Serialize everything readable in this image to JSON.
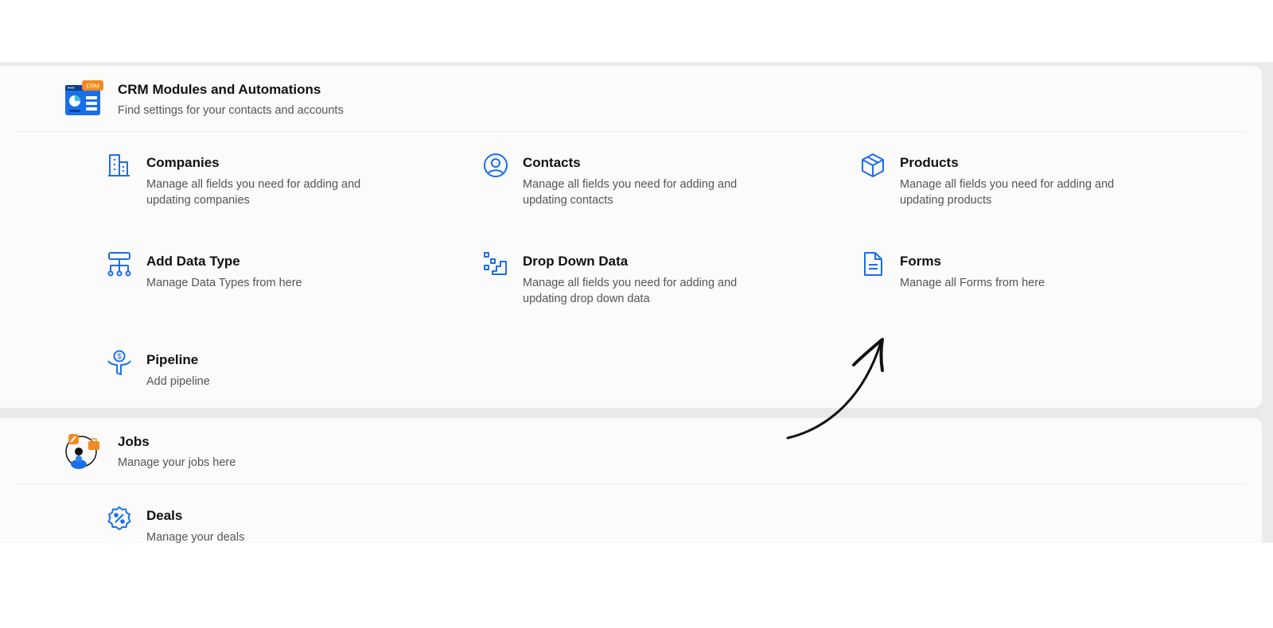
{
  "colors": {
    "accent": "#1a6fe8",
    "orange": "#f08c23",
    "panel_bg": "#fbfbfb",
    "page_gap": "#e9e9e9"
  },
  "crm": {
    "icon": "crm-illustration",
    "badge": "CRM",
    "title": "CRM Modules and Automations",
    "subtitle": "Find settings for your contacts and accounts",
    "items": [
      {
        "icon": "building-icon",
        "title": "Companies",
        "desc": "Manage all fields you need for adding and updating companies"
      },
      {
        "icon": "user-circle-icon",
        "title": "Contacts",
        "desc": "Manage all fields you need for adding and updating contacts"
      },
      {
        "icon": "cube-icon",
        "title": "Products",
        "desc": "Manage all fields you need for adding and updating products"
      },
      {
        "icon": "hierarchy-icon",
        "title": "Add Data Type",
        "desc": "Manage Data Types from here"
      },
      {
        "icon": "stairs-icon",
        "title": "Drop Down Data",
        "desc": "Manage all fields you need for adding and updating drop down data"
      },
      {
        "icon": "document-icon",
        "title": "Forms",
        "desc": "Manage all Forms from here"
      },
      {
        "icon": "funnel-dollar-icon",
        "title": "Pipeline",
        "desc": "Add pipeline"
      }
    ]
  },
  "jobs": {
    "icon": "jobs-illustration",
    "title": "Jobs",
    "subtitle": "Manage your jobs here",
    "items": [
      {
        "icon": "percent-badge-icon",
        "title": "Deals",
        "desc": "Manage your deals"
      }
    ]
  },
  "annotation": {
    "icon": "hand-drawn-arrow-icon"
  }
}
